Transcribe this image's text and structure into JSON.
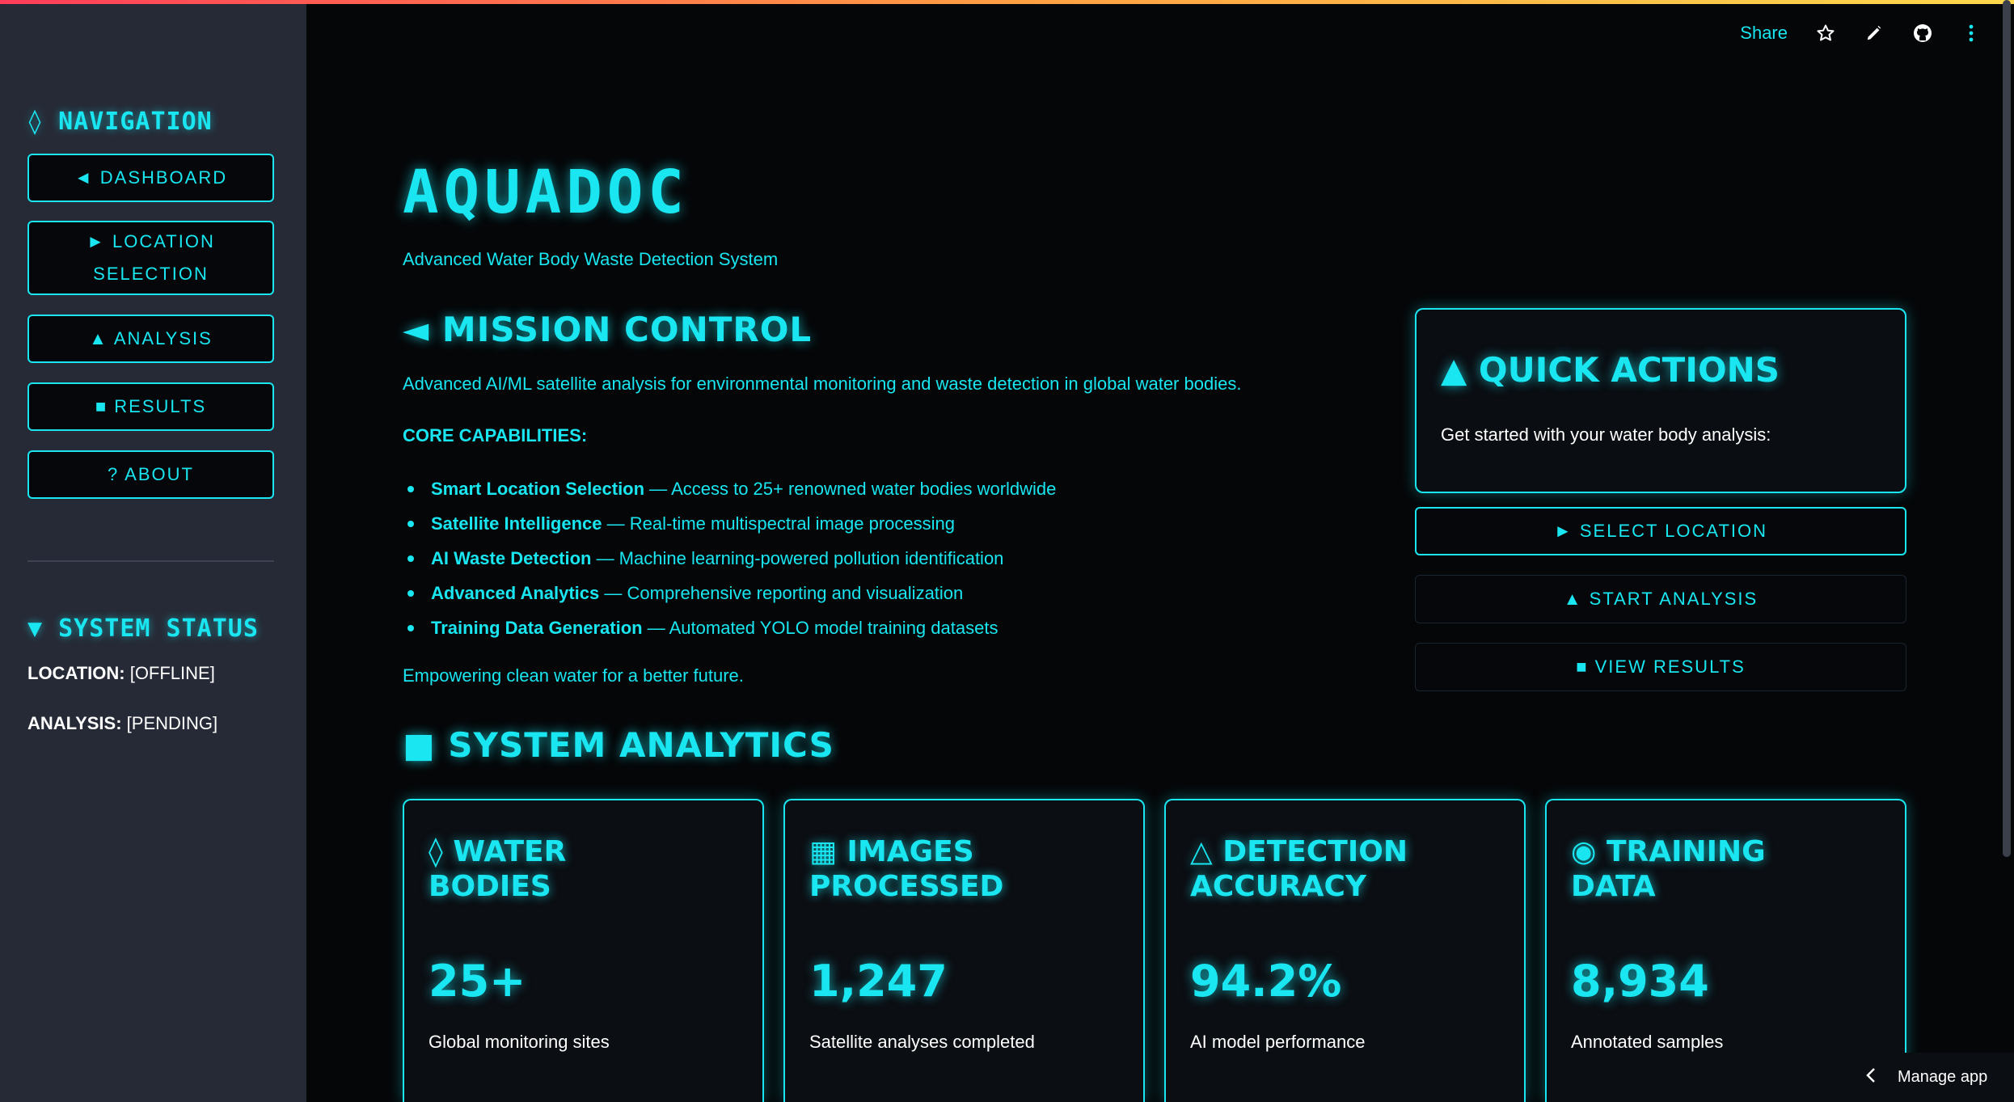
{
  "colors": {
    "accent": "#19e6f0",
    "background": "#050608",
    "sidebar": "#262a36"
  },
  "sidebar": {
    "nav_heading": "◊ NAVIGATION",
    "items": [
      {
        "label": "◄ DASHBOARD"
      },
      {
        "label": "► LOCATION SELECTION"
      },
      {
        "label": "▲ ANALYSIS"
      },
      {
        "label": "■ RESULTS"
      },
      {
        "label": "? ABOUT"
      }
    ],
    "status_heading": "▼ SYSTEM STATUS",
    "status": [
      {
        "label": "LOCATION:",
        "value": "[OFFLINE]"
      },
      {
        "label": "ANALYSIS:",
        "value": "[PENDING]"
      }
    ]
  },
  "toolbar": {
    "share_label": "Share",
    "icons": [
      "star-icon",
      "edit-icon",
      "github-icon",
      "more-icon"
    ]
  },
  "main": {
    "title": "AQUADOC",
    "subtitle": "Advanced Water Body Waste Detection System",
    "mission_heading": "◄ MISSION CONTROL",
    "mission_text": "Advanced AI/ML satellite analysis for environmental monitoring and waste detection in global water bodies.",
    "capabilities_heading": "CORE CAPABILITIES:",
    "capabilities": [
      {
        "name": "Smart Location Selection",
        "desc": " — Access to 25+ renowned water bodies worldwide"
      },
      {
        "name": "Satellite Intelligence",
        "desc": " — Real-time multispectral image processing"
      },
      {
        "name": "AI Waste Detection",
        "desc": " — Machine learning-powered pollution identification"
      },
      {
        "name": "Advanced Analytics",
        "desc": " — Comprehensive reporting and visualization"
      },
      {
        "name": "Training Data Generation",
        "desc": " — Automated YOLO model training datasets"
      }
    ],
    "tagline": "Empowering clean water for a better future.",
    "analytics_heading": "■ SYSTEM ANALYTICS"
  },
  "quick_actions": {
    "heading": "▲ QUICK ACTIONS",
    "text": "Get started with your water body analysis:",
    "buttons": [
      {
        "label": "► SELECT LOCATION"
      },
      {
        "label": "▲ START ANALYSIS"
      },
      {
        "label": "■ VIEW RESULTS"
      }
    ]
  },
  "metrics": [
    {
      "title": "◊ WATER BODIES",
      "value": "25+",
      "desc": "Global monitoring sites"
    },
    {
      "title": "▦ IMAGES PROCESSED",
      "value": "1,247",
      "desc": "Satellite analyses completed"
    },
    {
      "title": "△ DETECTION ACCURACY",
      "value": "94.2%",
      "desc": "AI model performance"
    },
    {
      "title": "◉ TRAINING DATA",
      "value": "8,934",
      "desc": "Annotated samples"
    }
  ],
  "manage": {
    "label": "Manage app"
  }
}
